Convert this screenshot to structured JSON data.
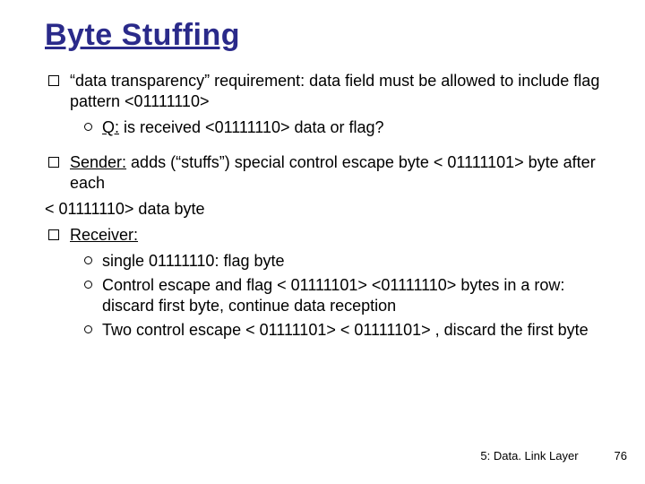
{
  "title": "Byte Stuffing",
  "bullets": {
    "b1": "“data transparency” requirement: data field must be allowed to include flag pattern  <01111110>",
    "b1_s1_pre": "Q:",
    "b1_s1_post": " is received <01111110> data or flag?",
    "b2_pre": "Sender:",
    "b2_post": " adds (“stuffs”) special control escape byte < 01111101> byte after each",
    "b2_cont": "< 01111110> data  byte",
    "b3_pre": "Receiver:",
    "b3_s1": "single 01111110: flag byte",
    "b3_s2": "Control escape and flag < 01111101> <01111110> bytes in a row: discard first byte, continue data reception",
    "b3_s3": "Two control escape < 01111101> < 01111101> , discard the first byte"
  },
  "footer": {
    "section": "5: Data. Link Layer",
    "page": "76"
  }
}
